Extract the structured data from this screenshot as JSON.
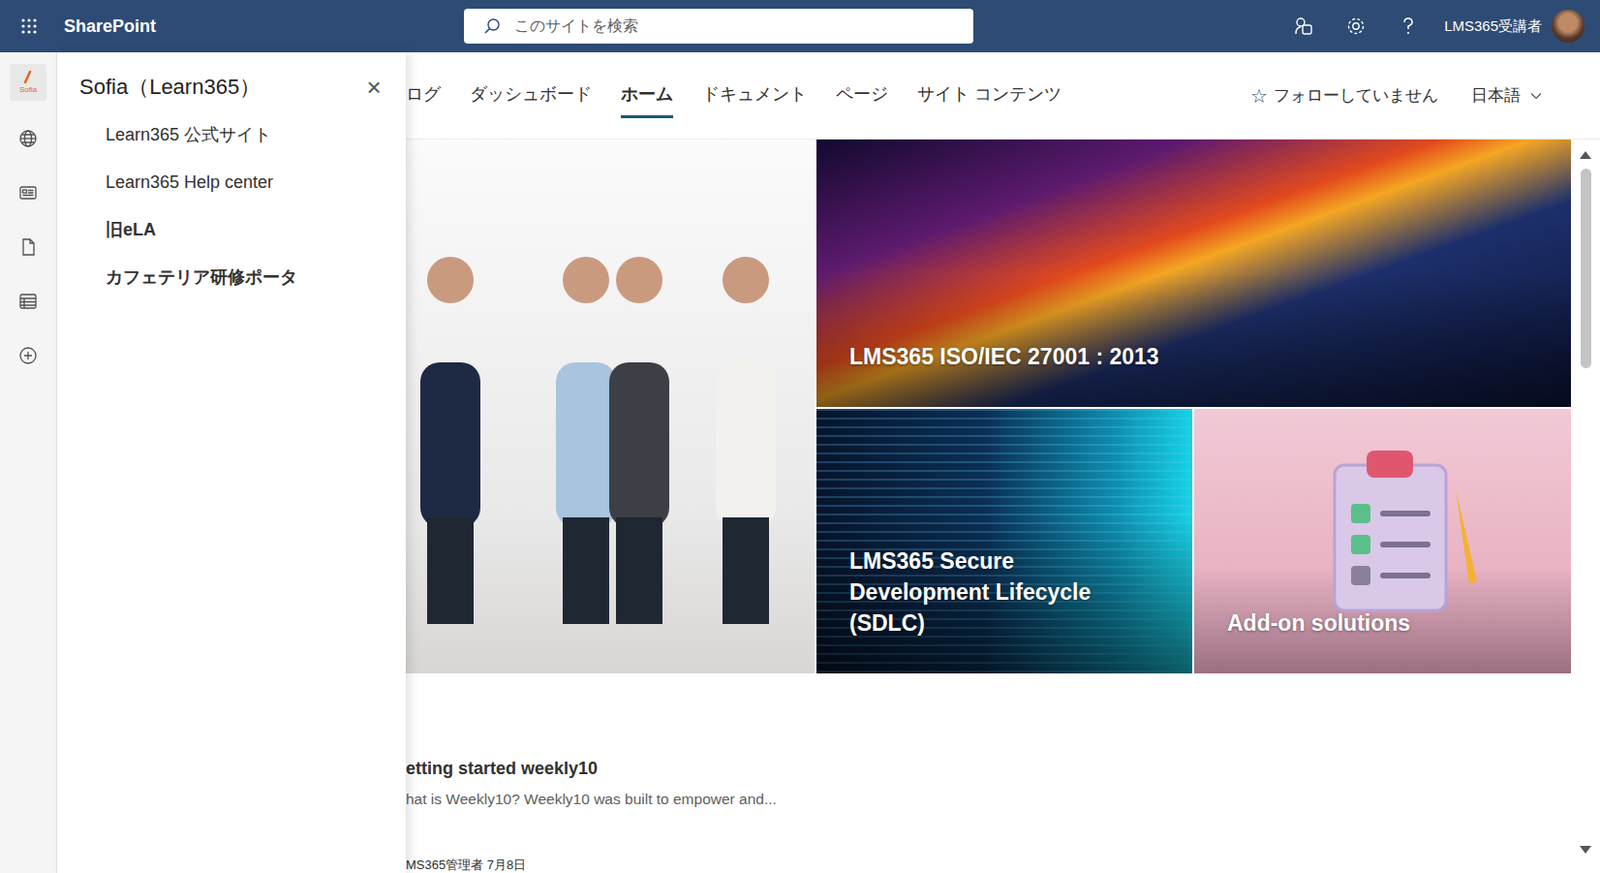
{
  "app": {
    "name": "SharePoint"
  },
  "search": {
    "placeholder": "このサイトを検索"
  },
  "user": {
    "name": "LMS365受講者"
  },
  "rail": {
    "logo": "Sofia",
    "items": [
      {
        "name": "globe",
        "selected": false
      },
      {
        "name": "news",
        "selected": false
      },
      {
        "name": "file",
        "selected": false
      },
      {
        "name": "list",
        "selected": false
      },
      {
        "name": "add",
        "selected": false
      }
    ]
  },
  "panel": {
    "title": "Sofia（Learn365）",
    "close": "×",
    "links": [
      {
        "label": "Learn365 公式サイト",
        "kind": "link"
      },
      {
        "label": "Learn365 Help center",
        "kind": "link"
      },
      {
        "label": "旧eLA",
        "kind": "heading"
      },
      {
        "label": "カフェテリア研修ポータ",
        "kind": "heading"
      }
    ]
  },
  "nav": [
    {
      "label": "ログ",
      "selected": false
    },
    {
      "label": "ダッシュボード",
      "selected": false
    },
    {
      "label": "ホーム",
      "selected": true
    },
    {
      "label": "ドキュメント",
      "selected": false
    },
    {
      "label": "ページ",
      "selected": false
    },
    {
      "label": "サイト コンテンツ",
      "selected": false
    }
  ],
  "follow": {
    "icon": "☆",
    "label": "フォローしていません"
  },
  "language": {
    "label": "日本語"
  },
  "hero": {
    "tiles": [
      {
        "title": "LMS365 ISO/IEC 27001 : 2013",
        "kind": "wide"
      },
      {
        "title": "LMS365 Secure Development Lifecycle (SDLC)",
        "kind": "code"
      },
      {
        "title": "Add-on solutions",
        "kind": "clipboard"
      }
    ]
  },
  "news": [
    {
      "title": "etting started weekly10",
      "summary": "hat is Weekly10? Weekly10 was built to empower and...",
      "meta": "MS365管理者 7月8日"
    }
  ]
}
